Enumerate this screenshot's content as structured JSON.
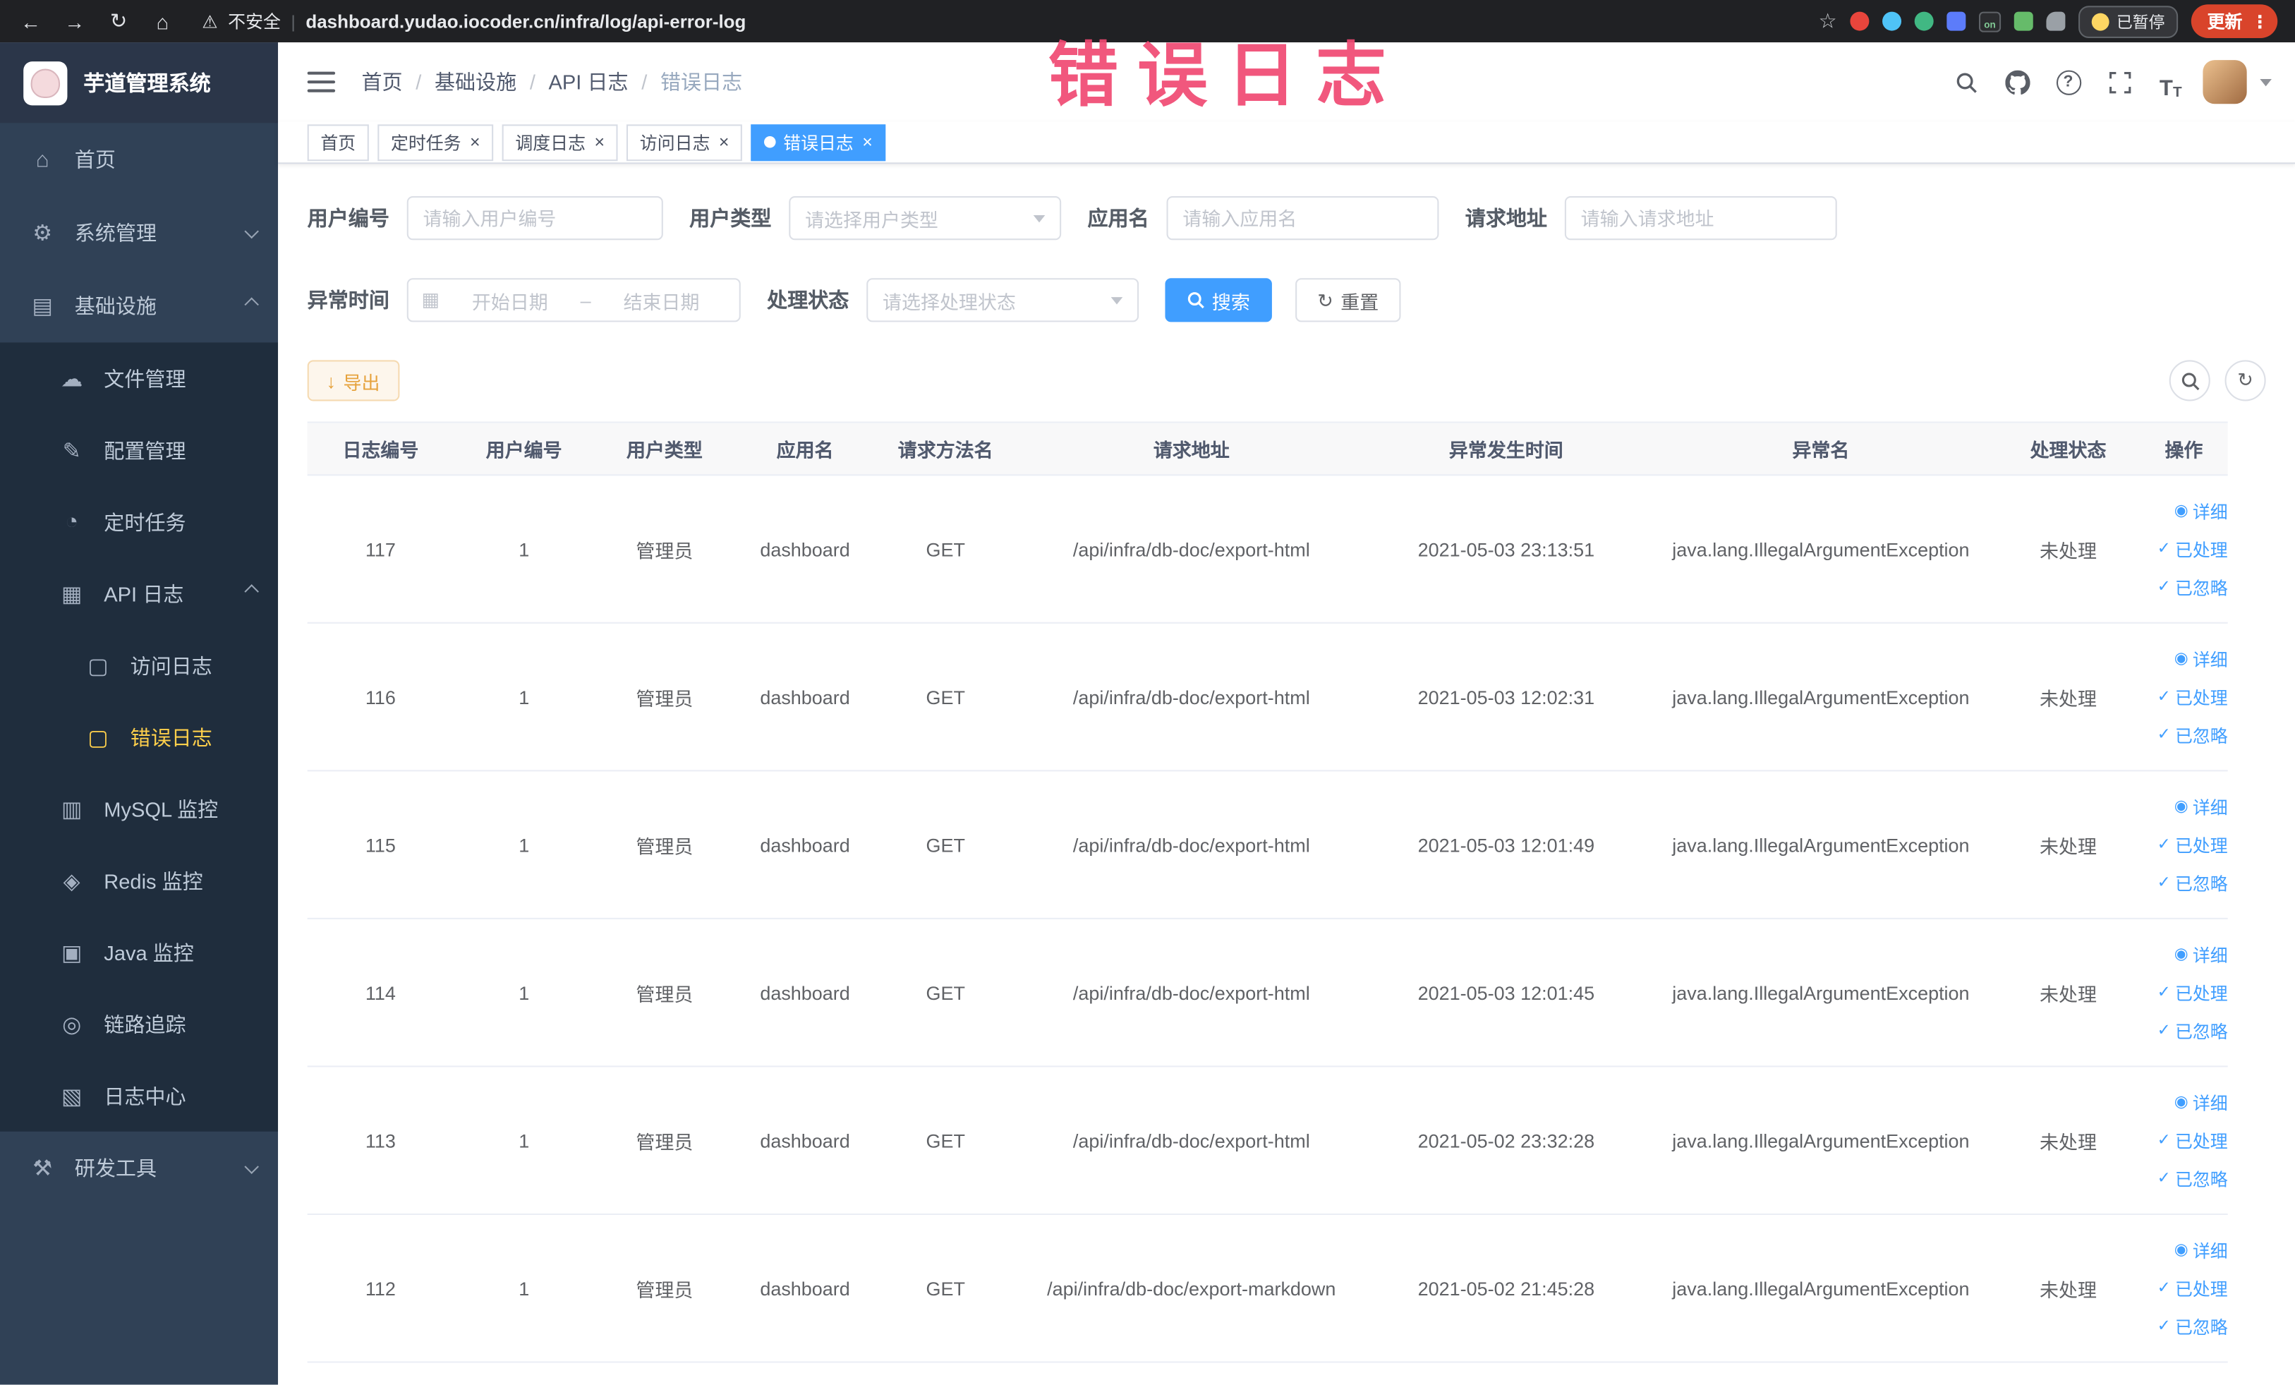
{
  "watermark": "错误日志",
  "browser": {
    "not_secure_label": "不安全",
    "url": "dashboard.yudao.iocoder.cn/infra/log/api-error-log",
    "paused_badge": "已暂停",
    "update_button": "更新"
  },
  "sidebar": {
    "logo_title": "芋道管理系统",
    "items": [
      {
        "label": "首页"
      },
      {
        "label": "系统管理"
      },
      {
        "label": "基础设施"
      },
      {
        "label": "文件管理"
      },
      {
        "label": "配置管理"
      },
      {
        "label": "定时任务"
      },
      {
        "label": "API 日志"
      },
      {
        "label": "访问日志"
      },
      {
        "label": "错误日志"
      },
      {
        "label": "MySQL 监控"
      },
      {
        "label": "Redis 监控"
      },
      {
        "label": "Java 监控"
      },
      {
        "label": "链路追踪"
      },
      {
        "label": "日志中心"
      },
      {
        "label": "研发工具"
      }
    ]
  },
  "header": {
    "breadcrumb": [
      "首页",
      "基础设施",
      "API 日志",
      "错误日志"
    ]
  },
  "tags": [
    "首页",
    "定时任务",
    "调度日志",
    "访问日志",
    "错误日志"
  ],
  "filters": {
    "user_id": {
      "label": "用户编号",
      "placeholder": "请输入用户编号"
    },
    "user_type": {
      "label": "用户类型",
      "placeholder": "请选择用户类型"
    },
    "app_name": {
      "label": "应用名",
      "placeholder": "请输入应用名"
    },
    "request_url": {
      "label": "请求地址",
      "placeholder": "请输入请求地址"
    },
    "exception_time": {
      "label": "异常时间",
      "start_placeholder": "开始日期",
      "separator": "–",
      "end_placeholder": "结束日期"
    },
    "process_status": {
      "label": "处理状态",
      "placeholder": "请选择处理状态"
    },
    "search_button": "搜索",
    "reset_button": "重置"
  },
  "toolbar": {
    "export_label": "导出"
  },
  "table": {
    "columns": [
      "日志编号",
      "用户编号",
      "用户类型",
      "应用名",
      "请求方法名",
      "请求地址",
      "异常发生时间",
      "异常名",
      "处理状态",
      "操作"
    ],
    "actions": {
      "detail": "详细",
      "processed": "已处理",
      "ignored": "已忽略"
    },
    "rows": [
      {
        "log_id": "117",
        "user_id": "1",
        "user_type": "管理员",
        "app_name": "dashboard",
        "method": "GET",
        "url": "/api/infra/db-doc/export-html",
        "time": "2021-05-03 23:13:51",
        "exception": "java.lang.IllegalArgumentException",
        "status": "未处理"
      },
      {
        "log_id": "116",
        "user_id": "1",
        "user_type": "管理员",
        "app_name": "dashboard",
        "method": "GET",
        "url": "/api/infra/db-doc/export-html",
        "time": "2021-05-03 12:02:31",
        "exception": "java.lang.IllegalArgumentException",
        "status": "未处理"
      },
      {
        "log_id": "115",
        "user_id": "1",
        "user_type": "管理员",
        "app_name": "dashboard",
        "method": "GET",
        "url": "/api/infra/db-doc/export-html",
        "time": "2021-05-03 12:01:49",
        "exception": "java.lang.IllegalArgumentException",
        "status": "未处理"
      },
      {
        "log_id": "114",
        "user_id": "1",
        "user_type": "管理员",
        "app_name": "dashboard",
        "method": "GET",
        "url": "/api/infra/db-doc/export-html",
        "time": "2021-05-03 12:01:45",
        "exception": "java.lang.IllegalArgumentException",
        "status": "未处理"
      },
      {
        "log_id": "113",
        "user_id": "1",
        "user_type": "管理员",
        "app_name": "dashboard",
        "method": "GET",
        "url": "/api/infra/db-doc/export-html",
        "time": "2021-05-02 23:32:28",
        "exception": "java.lang.IllegalArgumentException",
        "status": "未处理"
      },
      {
        "log_id": "112",
        "user_id": "1",
        "user_type": "管理员",
        "app_name": "dashboard",
        "method": "GET",
        "url": "/api/infra/db-doc/export-markdown",
        "time": "2021-05-02 21:45:28",
        "exception": "java.lang.IllegalArgumentException",
        "status": "未处理"
      }
    ]
  }
}
